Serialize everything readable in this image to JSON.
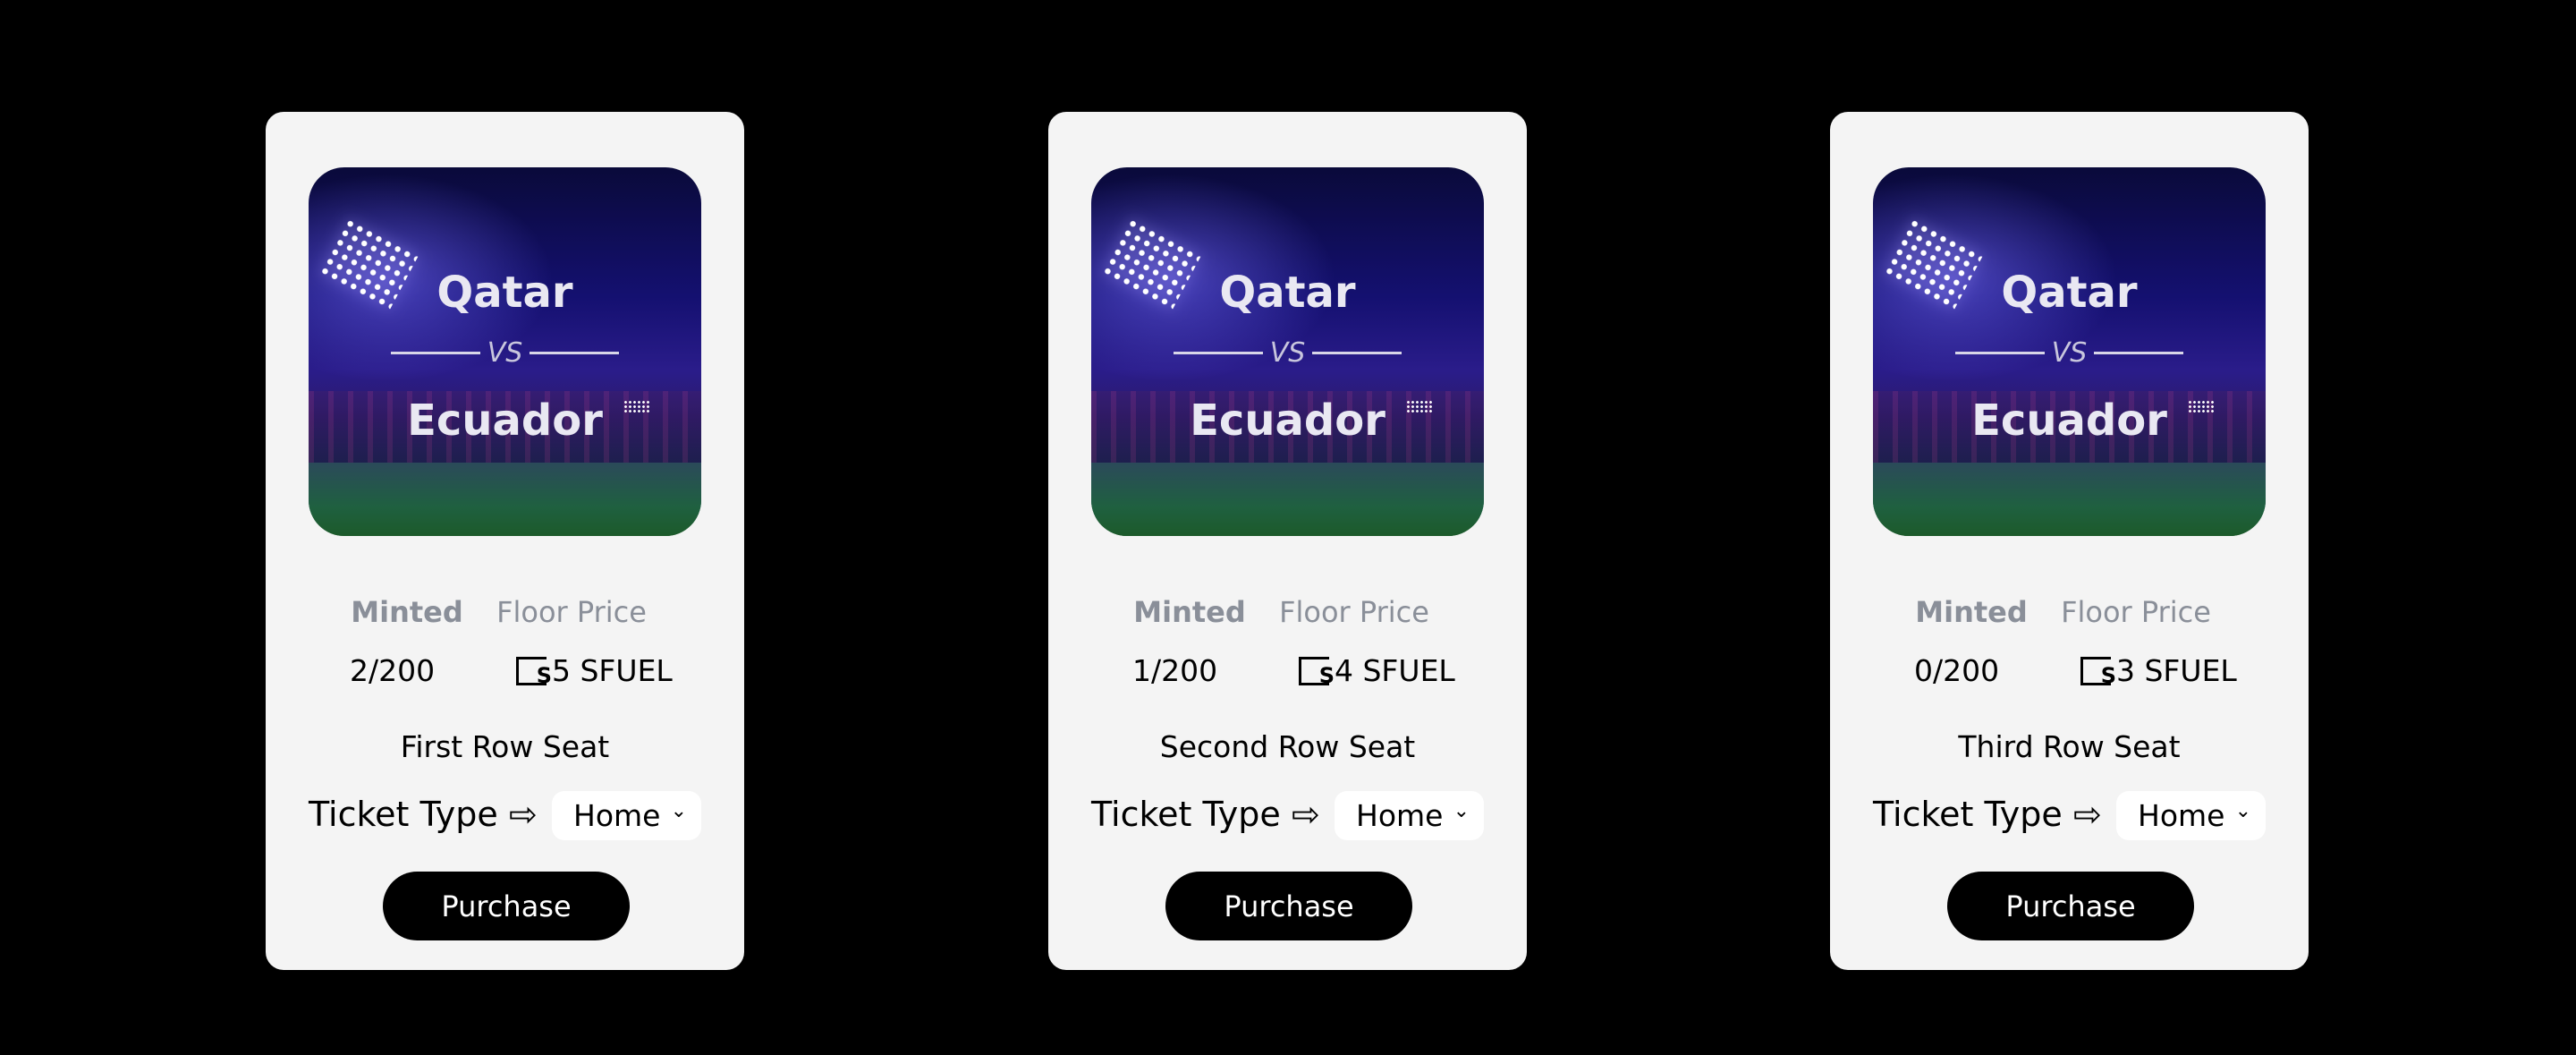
{
  "cards": [
    {
      "team1": "Qatar",
      "vs": "VS",
      "team2": "Ecuador",
      "minted_label": "Minted",
      "floor_label": "Floor Price",
      "minted": "2/200",
      "price": "5 SFUEL",
      "seat": "First Row Seat",
      "ticket_type_label": "Ticket Type ⇨",
      "ticket_type": "Home",
      "purchase": "Purchase"
    },
    {
      "team1": "Qatar",
      "vs": "VS",
      "team2": "Ecuador",
      "minted_label": "Minted",
      "floor_label": "Floor Price",
      "minted": "1/200",
      "price": "4 SFUEL",
      "seat": "Second Row Seat",
      "ticket_type_label": "Ticket Type ⇨",
      "ticket_type": "Home",
      "purchase": "Purchase"
    },
    {
      "team1": "Qatar",
      "vs": "VS",
      "team2": "Ecuador",
      "minted_label": "Minted",
      "floor_label": "Floor Price",
      "minted": "0/200",
      "price": "3 SFUEL",
      "seat": "Third Row Seat",
      "ticket_type_label": "Ticket Type ⇨",
      "ticket_type": "Home",
      "purchase": "Purchase"
    }
  ],
  "coin_symbol": "S"
}
